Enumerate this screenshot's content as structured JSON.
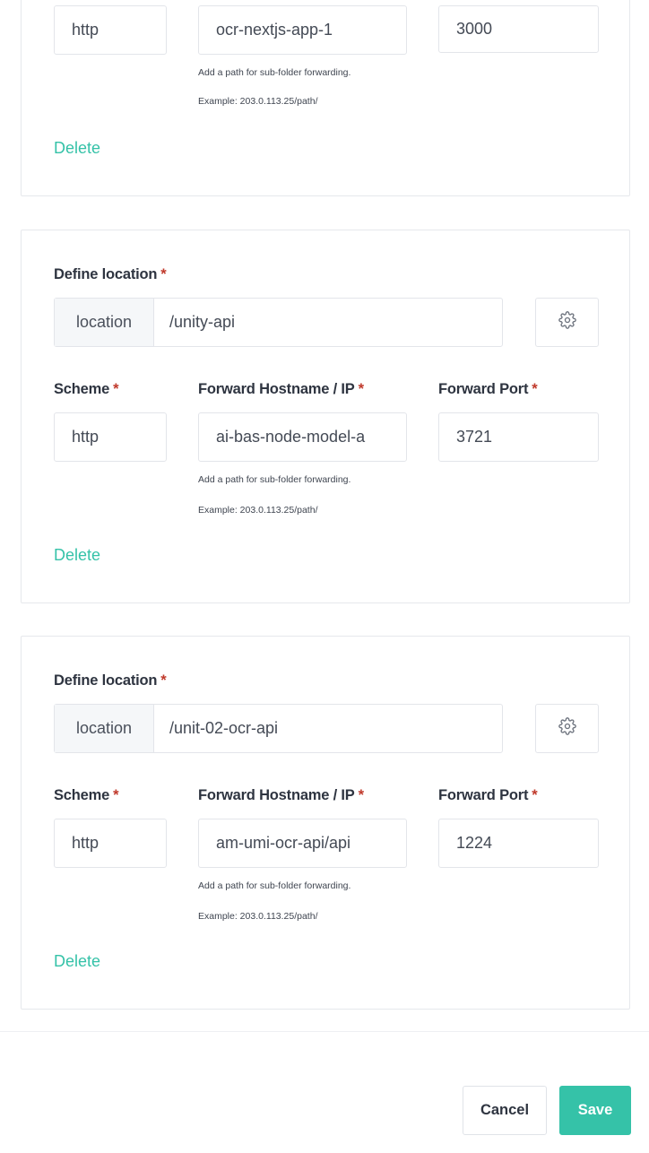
{
  "locations": [
    {
      "define_location_label": "",
      "location_addon": "",
      "location_value": "",
      "scheme_label": "",
      "host_label": "",
      "port_label": "",
      "scheme_value": "http",
      "host_value": "ocr-nextjs-app-1",
      "port_value": "3000",
      "hint_path": "Add a path for sub-folder forwarding.",
      "hint_example": "Example: 203.0.113.25/path/",
      "delete_label": "Delete"
    },
    {
      "define_location_label": "Define location",
      "location_addon": "location",
      "location_value": "/unity-api",
      "scheme_label": "Scheme",
      "host_label": "Forward Hostname / IP",
      "port_label": "Forward Port",
      "scheme_value": "http",
      "host_value": "ai-bas-node-model-a",
      "port_value": "3721",
      "hint_path": "Add a path for sub-folder forwarding.",
      "hint_example": "Example: 203.0.113.25/path/",
      "delete_label": "Delete"
    },
    {
      "define_location_label": "Define location",
      "location_addon": "location",
      "location_value": "/unit-02-ocr-api",
      "scheme_label": "Scheme",
      "host_label": "Forward Hostname / IP",
      "port_label": "Forward Port",
      "scheme_value": "http",
      "host_value": "am-umi-ocr-api/api",
      "port_value": "1224",
      "hint_path": "Add a path for sub-folder forwarding.",
      "hint_example": "Example: 203.0.113.25/path/",
      "delete_label": "Delete"
    }
  ],
  "required_marker": "*",
  "footer": {
    "cancel_label": "Cancel",
    "save_label": "Save"
  },
  "colors": {
    "accent": "#35c2a8",
    "required": "#c0392b"
  },
  "icons": {
    "settings": "gear-icon"
  }
}
